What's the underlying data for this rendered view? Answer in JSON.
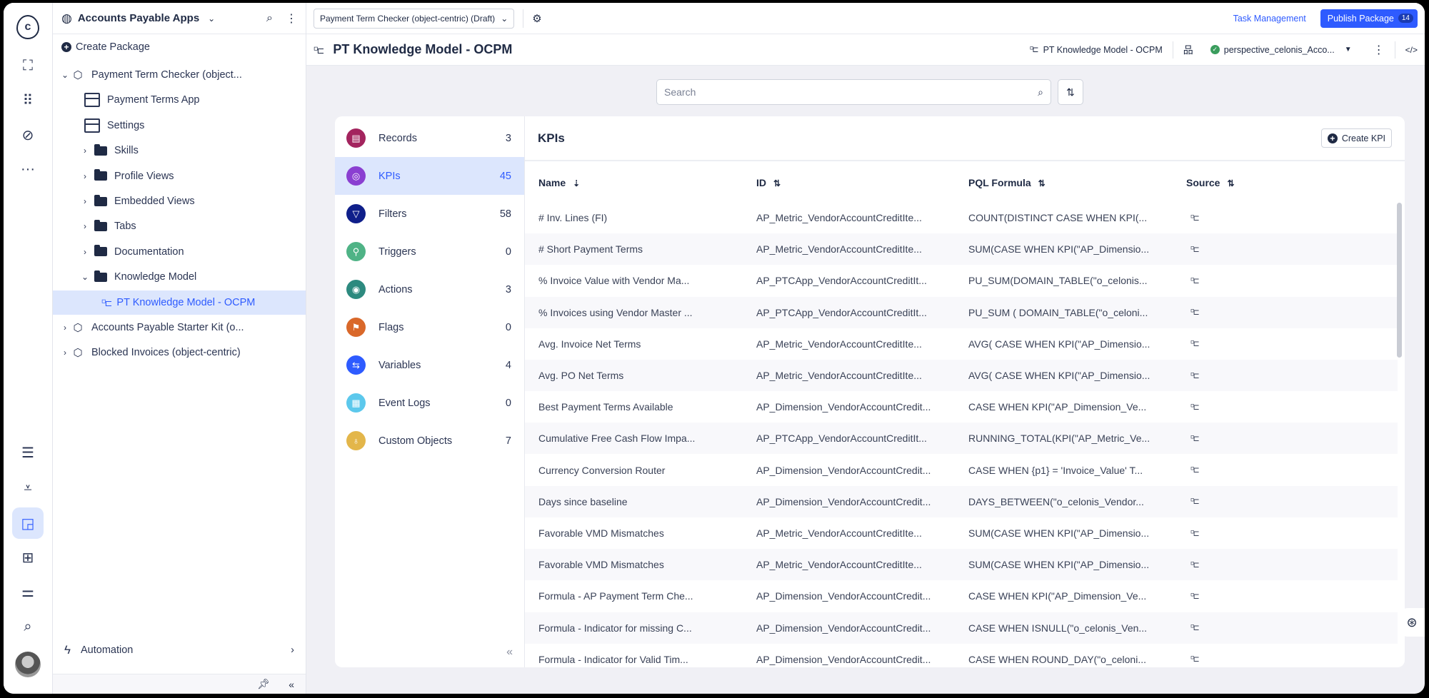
{
  "rail": {
    "logo": "c",
    "top_icons": [
      "process-icon",
      "apps-grid-icon",
      "compass-icon",
      "more-icon"
    ],
    "bottom_icons": [
      "data-icon",
      "ingest-icon",
      "studio-icon",
      "marketplace-icon",
      "settings-sliders-icon",
      "search-icon"
    ]
  },
  "tree": {
    "space_title": "Accounts Payable Apps",
    "create_package": "Create Package",
    "items": [
      {
        "label": "Payment Term Checker (object...",
        "type": "package",
        "expanded": true,
        "level": 0
      },
      {
        "label": "Payment Terms App",
        "type": "app",
        "level": 1
      },
      {
        "label": "Settings",
        "type": "app",
        "level": 1
      },
      {
        "label": "Skills",
        "type": "folder",
        "level": 1
      },
      {
        "label": "Profile Views",
        "type": "folder",
        "level": 1
      },
      {
        "label": "Embedded Views",
        "type": "folder",
        "level": 1
      },
      {
        "label": "Tabs",
        "type": "folder",
        "level": 1
      },
      {
        "label": "Documentation",
        "type": "folder",
        "level": 1
      },
      {
        "label": "Knowledge Model",
        "type": "folder",
        "expanded": true,
        "level": 1
      },
      {
        "label": "PT Knowledge Model - OCPM",
        "type": "knowledge-model",
        "selected": true,
        "level": 2
      },
      {
        "label": "Accounts Payable Starter Kit (o...",
        "type": "package",
        "level": 0
      },
      {
        "label": "Blocked Invoices (object-centric)",
        "type": "package",
        "level": 0
      }
    ],
    "automation": "Automation"
  },
  "topbar": {
    "package_select": "Payment Term Checker (object-centric) (Draft)",
    "task_management": "Task Management",
    "publish": "Publish Package",
    "publish_count": "14"
  },
  "header": {
    "title": "PT Knowledge Model - OCPM",
    "km_label": "PT Knowledge Model - OCPM",
    "perspective": "perspective_celonis_Acco..."
  },
  "search": {
    "placeholder": "Search"
  },
  "categories": [
    {
      "label": "Records",
      "count": "3",
      "color": "#a3245e",
      "icon": "▤"
    },
    {
      "label": "KPIs",
      "count": "45",
      "color": "#8a3fd1",
      "icon": "◎",
      "selected": true
    },
    {
      "label": "Filters",
      "count": "58",
      "color": "#0f1f8a",
      "icon": "▽"
    },
    {
      "label": "Triggers",
      "count": "0",
      "color": "#4fb386",
      "icon": "⚲"
    },
    {
      "label": "Actions",
      "count": "3",
      "color": "#2d8a7f",
      "icon": "◉"
    },
    {
      "label": "Flags",
      "count": "0",
      "color": "#d9682a",
      "icon": "⚑"
    },
    {
      "label": "Variables",
      "count": "4",
      "color": "#2e5bff",
      "icon": "⇆"
    },
    {
      "label": "Event Logs",
      "count": "0",
      "color": "#5cc8ec",
      "icon": "▦"
    },
    {
      "label": "Custom Objects",
      "count": "7",
      "color": "#e3b64a",
      "icon": "♁"
    }
  ],
  "kpis": {
    "title": "KPIs",
    "create": "Create KPI",
    "columns": [
      "Name",
      "ID",
      "PQL Formula",
      "Source"
    ],
    "rows": [
      [
        "# Inv. Lines (FI)",
        "AP_Metric_VendorAccountCreditIte...",
        "COUNT(DISTINCT CASE WHEN KPI(..."
      ],
      [
        "# Short Payment Terms",
        "AP_Metric_VendorAccountCreditIte...",
        "SUM(CASE WHEN KPI(\"AP_Dimensio..."
      ],
      [
        "% Invoice Value with Vendor Ma...",
        "AP_PTCApp_VendorAccountCreditIt...",
        "PU_SUM(DOMAIN_TABLE(\"o_celonis..."
      ],
      [
        "% Invoices using Vendor Master ...",
        "AP_PTCApp_VendorAccountCreditIt...",
        "PU_SUM ( DOMAIN_TABLE(\"o_celoni..."
      ],
      [
        "Avg. Invoice Net Terms",
        "AP_Metric_VendorAccountCreditIte...",
        "AVG( CASE WHEN KPI(\"AP_Dimensio..."
      ],
      [
        "Avg. PO Net Terms",
        "AP_Metric_VendorAccountCreditIte...",
        "AVG( CASE WHEN KPI(\"AP_Dimensio..."
      ],
      [
        "Best Payment Terms Available",
        "AP_Dimension_VendorAccountCredit...",
        "CASE WHEN KPI(\"AP_Dimension_Ve..."
      ],
      [
        "Cumulative Free Cash Flow Impa...",
        "AP_PTCApp_VendorAccountCreditIt...",
        "RUNNING_TOTAL(KPI(\"AP_Metric_Ve..."
      ],
      [
        "Currency Conversion Router",
        "AP_Dimension_VendorAccountCredit...",
        "CASE WHEN {p1} = 'Invoice_Value' T..."
      ],
      [
        "Days since baseline",
        "AP_Dimension_VendorAccountCredit...",
        "DAYS_BETWEEN(\"o_celonis_Vendor..."
      ],
      [
        "Favorable VMD Mismatches",
        "AP_Metric_VendorAccountCreditIte...",
        "SUM(CASE WHEN KPI(\"AP_Dimensio..."
      ],
      [
        "Favorable VMD Mismatches",
        "AP_Metric_VendorAccountCreditIte...",
        "SUM(CASE WHEN KPI(\"AP_Dimensio..."
      ],
      [
        "Formula - AP Payment Term Che...",
        "AP_Dimension_VendorAccountCredit...",
        "CASE WHEN KPI(\"AP_Dimension_Ve..."
      ],
      [
        "Formula - Indicator for missing C...",
        "AP_Dimension_VendorAccountCredit...",
        "CASE WHEN ISNULL(\"o_celonis_Ven..."
      ],
      [
        "Formula - Indicator for Valid Tim...",
        "AP_Dimension_VendorAccountCredit...",
        "CASE WHEN ROUND_DAY(\"o_celoni..."
      ]
    ]
  }
}
